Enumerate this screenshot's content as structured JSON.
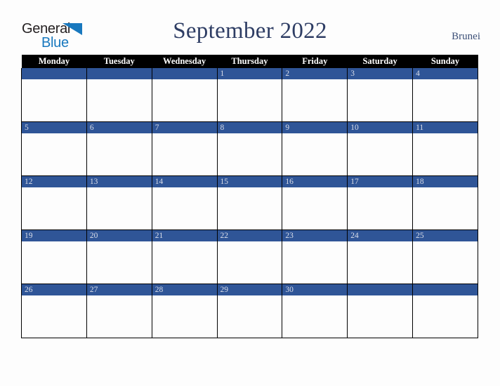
{
  "brand": {
    "name_part1": "General",
    "name_part2": "Blue",
    "triangle_icon": "triangle-icon",
    "color_dark": "#231f20",
    "color_blue": "#1878be"
  },
  "header": {
    "title": "September 2022",
    "country": "Brunei",
    "title_color": "#2e3d64"
  },
  "calendar": {
    "weekday_headers": [
      "Monday",
      "Tuesday",
      "Wednesday",
      "Thursday",
      "Friday",
      "Saturday",
      "Sunday"
    ],
    "header_bg": "#000000",
    "header_text_color": "#ffffff",
    "daybar_bg": "#2f5597",
    "daybar_text_color": "#d9dde8",
    "cell_bg": "#fdfdfd",
    "border_color": "#000000",
    "weeks": [
      [
        "",
        "",
        "",
        "1",
        "2",
        "3",
        "4"
      ],
      [
        "5",
        "6",
        "7",
        "8",
        "9",
        "10",
        "11"
      ],
      [
        "12",
        "13",
        "14",
        "15",
        "16",
        "17",
        "18"
      ],
      [
        "19",
        "20",
        "21",
        "22",
        "23",
        "24",
        "25"
      ],
      [
        "26",
        "27",
        "28",
        "29",
        "30",
        "",
        ""
      ]
    ]
  }
}
